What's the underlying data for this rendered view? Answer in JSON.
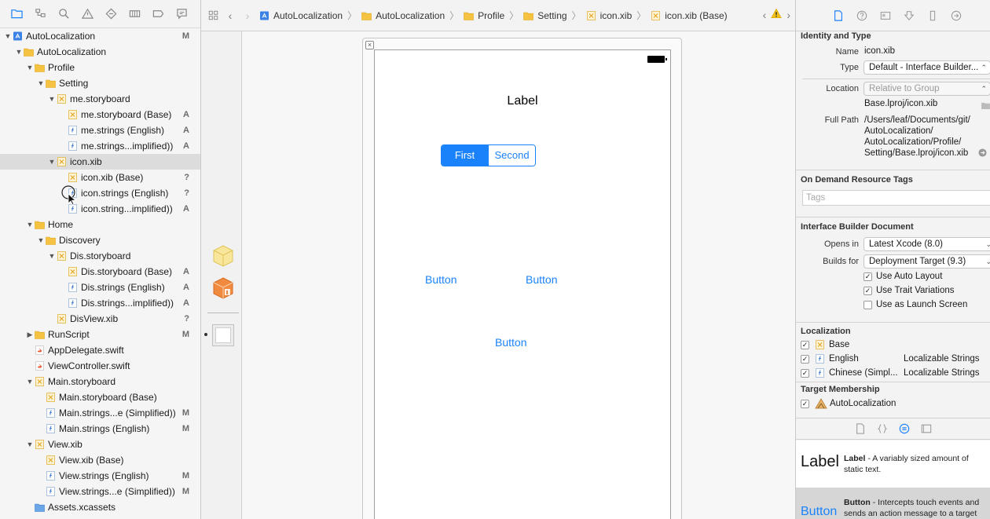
{
  "navigator": {
    "toolbar_icons": [
      "folder-icon",
      "hierarchy-icon",
      "search-icon",
      "warning-icon",
      "test-diamond-icon",
      "debug-gauge-icon",
      "breakpoint-icon",
      "report-icon"
    ],
    "tree": [
      {
        "label": "AutoLocalization",
        "depth": 0,
        "icon": "project",
        "expanded": true,
        "badge": "M"
      },
      {
        "label": "AutoLocalization",
        "depth": 1,
        "icon": "folder",
        "expanded": true,
        "badge": ""
      },
      {
        "label": "Profile",
        "depth": 2,
        "icon": "folder",
        "expanded": true,
        "badge": ""
      },
      {
        "label": "Setting",
        "depth": 3,
        "icon": "folder",
        "expanded": true,
        "badge": ""
      },
      {
        "label": "me.storyboard",
        "depth": 4,
        "icon": "xib",
        "expanded": true,
        "badge": ""
      },
      {
        "label": "me.storyboard (Base)",
        "depth": 5,
        "icon": "xib",
        "badge": "A"
      },
      {
        "label": "me.strings (English)",
        "depth": 5,
        "icon": "strings",
        "badge": "A"
      },
      {
        "label": "me.strings...implified))",
        "depth": 5,
        "icon": "strings",
        "badge": "A"
      },
      {
        "label": "icon.xib",
        "depth": 4,
        "icon": "xib",
        "expanded": true,
        "badge": "",
        "selected": true
      },
      {
        "label": "icon.xib (Base)",
        "depth": 5,
        "icon": "xib",
        "badge": "?"
      },
      {
        "label": "icon.strings (English)",
        "depth": 5,
        "icon": "strings",
        "badge": "?"
      },
      {
        "label": "icon.string...implified))",
        "depth": 5,
        "icon": "strings",
        "badge": "A"
      },
      {
        "label": "Home",
        "depth": 2,
        "icon": "folder",
        "expanded": true,
        "badge": ""
      },
      {
        "label": "Discovery",
        "depth": 3,
        "icon": "folder",
        "expanded": true,
        "badge": ""
      },
      {
        "label": "Dis.storyboard",
        "depth": 4,
        "icon": "xib",
        "expanded": true,
        "badge": ""
      },
      {
        "label": "Dis.storyboard (Base)",
        "depth": 5,
        "icon": "xib",
        "badge": "A"
      },
      {
        "label": "Dis.strings (English)",
        "depth": 5,
        "icon": "strings",
        "badge": "A"
      },
      {
        "label": "Dis.strings...implified))",
        "depth": 5,
        "icon": "strings",
        "badge": "A"
      },
      {
        "label": "DisView.xib",
        "depth": 4,
        "icon": "xib",
        "badge": "?"
      },
      {
        "label": "RunScript",
        "depth": 2,
        "icon": "folder",
        "expanded": false,
        "badge": "M"
      },
      {
        "label": "AppDelegate.swift",
        "depth": 2,
        "icon": "swift",
        "badge": ""
      },
      {
        "label": "ViewController.swift",
        "depth": 2,
        "icon": "swift",
        "badge": ""
      },
      {
        "label": "Main.storyboard",
        "depth": 2,
        "icon": "xib",
        "expanded": true,
        "badge": ""
      },
      {
        "label": "Main.storyboard (Base)",
        "depth": 3,
        "icon": "xib",
        "badge": ""
      },
      {
        "label": "Main.strings...e (Simplified))",
        "depth": 3,
        "icon": "strings",
        "badge": "M"
      },
      {
        "label": "Main.strings (English)",
        "depth": 3,
        "icon": "strings",
        "badge": "M"
      },
      {
        "label": "View.xib",
        "depth": 2,
        "icon": "xib",
        "expanded": true,
        "badge": ""
      },
      {
        "label": "View.xib (Base)",
        "depth": 3,
        "icon": "xib",
        "badge": ""
      },
      {
        "label": "View.strings (English)",
        "depth": 3,
        "icon": "strings",
        "badge": "M"
      },
      {
        "label": "View.strings...e (Simplified))",
        "depth": 3,
        "icon": "strings",
        "badge": "M"
      },
      {
        "label": "Assets.xcassets",
        "depth": 2,
        "icon": "assets",
        "badge": ""
      }
    ]
  },
  "jumpbar": {
    "crumbs": [
      {
        "label": "AutoLocalization",
        "icon": "project"
      },
      {
        "label": "AutoLocalization",
        "icon": "folder"
      },
      {
        "label": "Profile",
        "icon": "folder"
      },
      {
        "label": "Setting",
        "icon": "folder"
      },
      {
        "label": "icon.xib",
        "icon": "xib"
      },
      {
        "label": "icon.xib (Base)",
        "icon": "xib"
      }
    ]
  },
  "canvas": {
    "label_text": "Label",
    "segment_first": "First",
    "segment_second": "Second",
    "button_left": "Button",
    "button_right": "Button",
    "button_center": "Button"
  },
  "inspector": {
    "identity": {
      "title": "Identity and Type",
      "name_label": "Name",
      "name_value": "icon.xib",
      "type_label": "Type",
      "type_value": "Default - Interface Builder...",
      "location_label": "Location",
      "location_value": "Relative to Group",
      "location_file": "Base.lproj/icon.xib",
      "fullpath_label": "Full Path",
      "fullpath_lines": [
        "/Users/leaf/Documents/git/",
        "AutoLocalization/",
        "AutoLocalization/Profile/",
        "Setting/Base.lproj/icon.xib"
      ]
    },
    "tags": {
      "title": "On Demand Resource Tags",
      "placeholder": "Tags"
    },
    "ib_document": {
      "title": "Interface Builder Document",
      "opens_in_label": "Opens in",
      "opens_in_value": "Latest Xcode (8.0)",
      "builds_for_label": "Builds for",
      "builds_for_value": "Deployment Target (9.3)",
      "options": [
        {
          "label": "Use Auto Layout",
          "checked": true
        },
        {
          "label": "Use Trait Variations",
          "checked": true
        },
        {
          "label": "Use as Launch Screen",
          "checked": false
        }
      ]
    },
    "localization": {
      "title": "Localization",
      "items": [
        {
          "name": "Base",
          "type": "",
          "checked": true,
          "icon": "xib"
        },
        {
          "name": "English",
          "type": "Localizable Strings",
          "checked": true,
          "icon": "strings"
        },
        {
          "name": "Chinese (Simpl...",
          "type": "Localizable Strings",
          "checked": true,
          "icon": "strings"
        }
      ]
    },
    "target_membership": {
      "title": "Target Membership",
      "target": "AutoLocalization",
      "checked": true
    },
    "library": {
      "items": [
        {
          "big": "Label",
          "name": "Label",
          "desc": " - A variably sized amount of static text."
        },
        {
          "big": "Button",
          "name": "Button",
          "desc": " - Intercepts touch events and sends an action message to a target"
        }
      ]
    }
  },
  "colors": {
    "accent": "#1a82fb",
    "folder": "#f5c242",
    "xib": "#f0c04a",
    "selection": "#dcdcdc"
  }
}
